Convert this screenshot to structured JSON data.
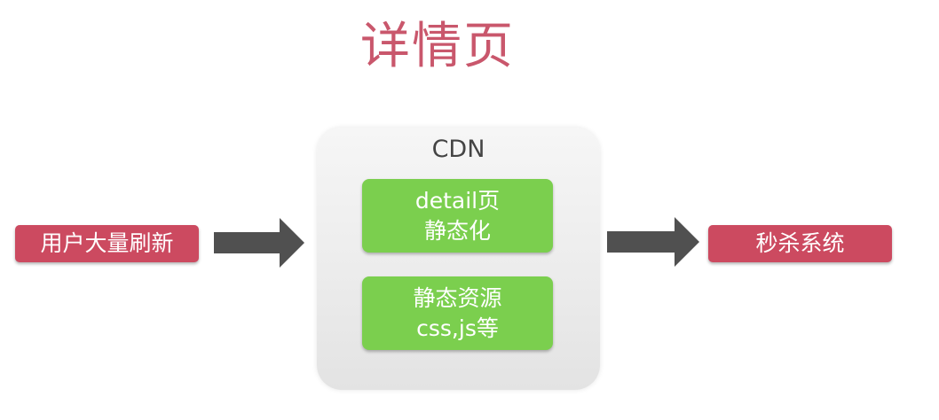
{
  "title": "详情页",
  "cdn": {
    "label": "CDN",
    "items": [
      {
        "line1": "detail页",
        "line2": "静态化"
      },
      {
        "line1": "静态资源",
        "line2": "css,js等"
      }
    ]
  },
  "source": {
    "label": "用户大量刷新"
  },
  "target": {
    "label": "秒杀系统"
  },
  "colors": {
    "title": "#c9576c",
    "red_box": "#cc4a60",
    "green_box": "#7bcf4e",
    "arrow": "#505050",
    "cdn_box": "#ececec"
  }
}
